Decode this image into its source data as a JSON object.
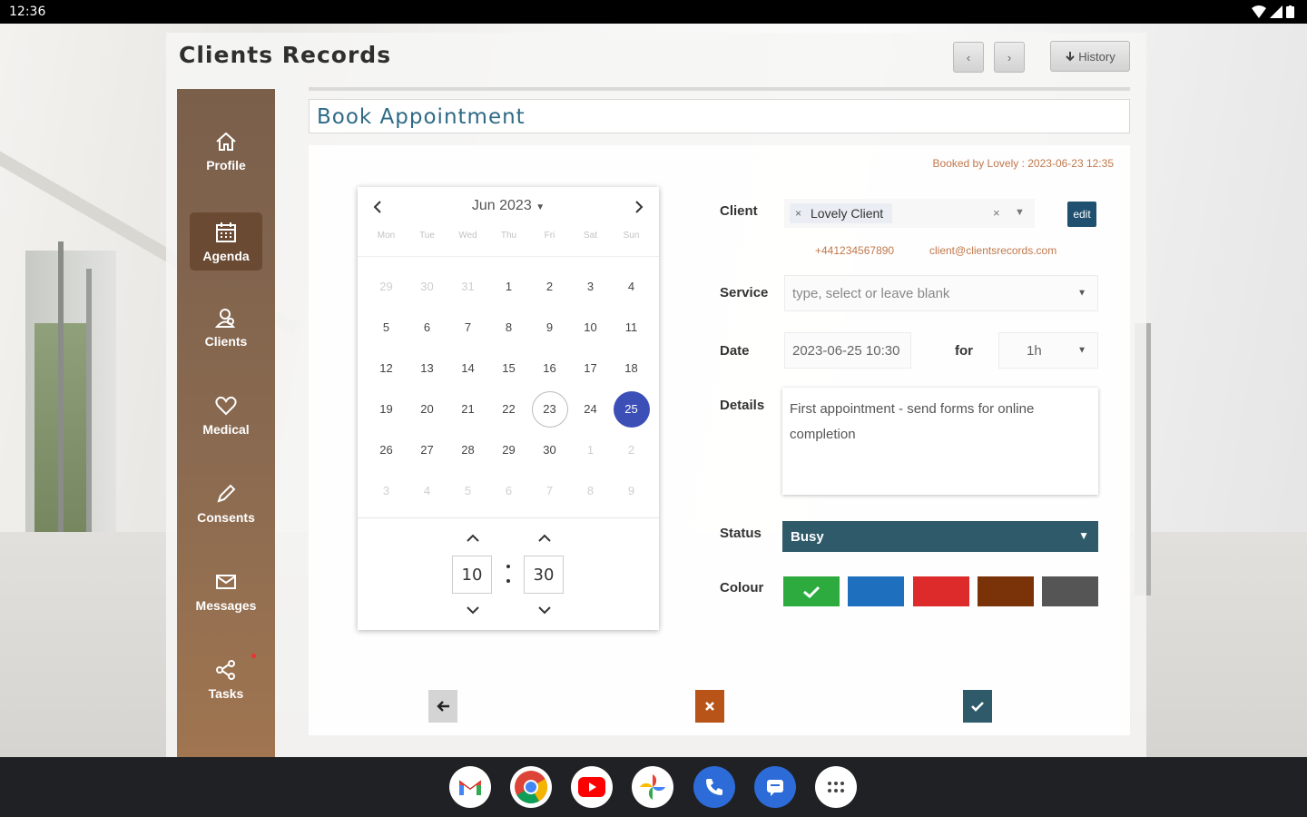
{
  "status_bar": {
    "time": "12:36"
  },
  "app": {
    "title": "Clients Records",
    "prev_label": "‹",
    "next_label": "›",
    "history_label": "History"
  },
  "sidebar": {
    "items": [
      {
        "label": "Profile",
        "icon": "home-icon"
      },
      {
        "label": "Agenda",
        "icon": "calendar-icon",
        "active": true
      },
      {
        "label": "Clients",
        "icon": "clients-icon"
      },
      {
        "label": "Medical",
        "icon": "heart-icon"
      },
      {
        "label": "Consents",
        "icon": "pen-icon"
      },
      {
        "label": "Messages",
        "icon": "mail-icon"
      },
      {
        "label": "Tasks",
        "icon": "share-icon"
      }
    ]
  },
  "page": {
    "title": "Book Appointment",
    "booked_by": "Booked by Lovely : 2023-06-23 12:35"
  },
  "calendar": {
    "month_label": "Jun 2023",
    "weekdays": [
      "Mon",
      "Tue",
      "Wed",
      "Thu",
      "Fri",
      "Sat",
      "Sun"
    ],
    "weeks": [
      [
        "29",
        "30",
        "31",
        "1",
        "2",
        "3",
        "4"
      ],
      [
        "5",
        "6",
        "7",
        "8",
        "9",
        "10",
        "11"
      ],
      [
        "12",
        "13",
        "14",
        "15",
        "16",
        "17",
        "18"
      ],
      [
        "19",
        "20",
        "21",
        "22",
        "23",
        "24",
        "25"
      ],
      [
        "26",
        "27",
        "28",
        "29",
        "30",
        "1",
        "2"
      ],
      [
        "3",
        "4",
        "5",
        "6",
        "7",
        "8",
        "9"
      ]
    ],
    "today": "23",
    "selected": "25",
    "hour": "10",
    "minute": "30"
  },
  "form": {
    "client_label": "Client",
    "client_value": "Lovely Client",
    "edit_label": "edit",
    "phone": "+441234567890",
    "email": "client@clientsrecords.com",
    "service_label": "Service",
    "service_placeholder": "type, select or leave blank",
    "date_label": "Date",
    "date_value": "2023-06-25 10:30",
    "for_label": "for",
    "duration_value": "1h",
    "details_label": "Details",
    "details_value": "First appointment - send forms for online completion",
    "status_label": "Status",
    "status_value": "Busy",
    "colour_label": "Colour",
    "colours": [
      "#2eab3e",
      "#1f6fbf",
      "#dd2a2a",
      "#7a3208",
      "#555555"
    ],
    "selected_colour": "#2eab3e"
  },
  "actions": {
    "back_color": "#d4d4d4",
    "cancel_color": "#b85418",
    "confirm_color": "#2f5a6a"
  },
  "dock": [
    "gmail-icon",
    "chrome-icon",
    "youtube-icon",
    "photos-icon",
    "phone-icon",
    "messages-icon",
    "apps-icon"
  ]
}
